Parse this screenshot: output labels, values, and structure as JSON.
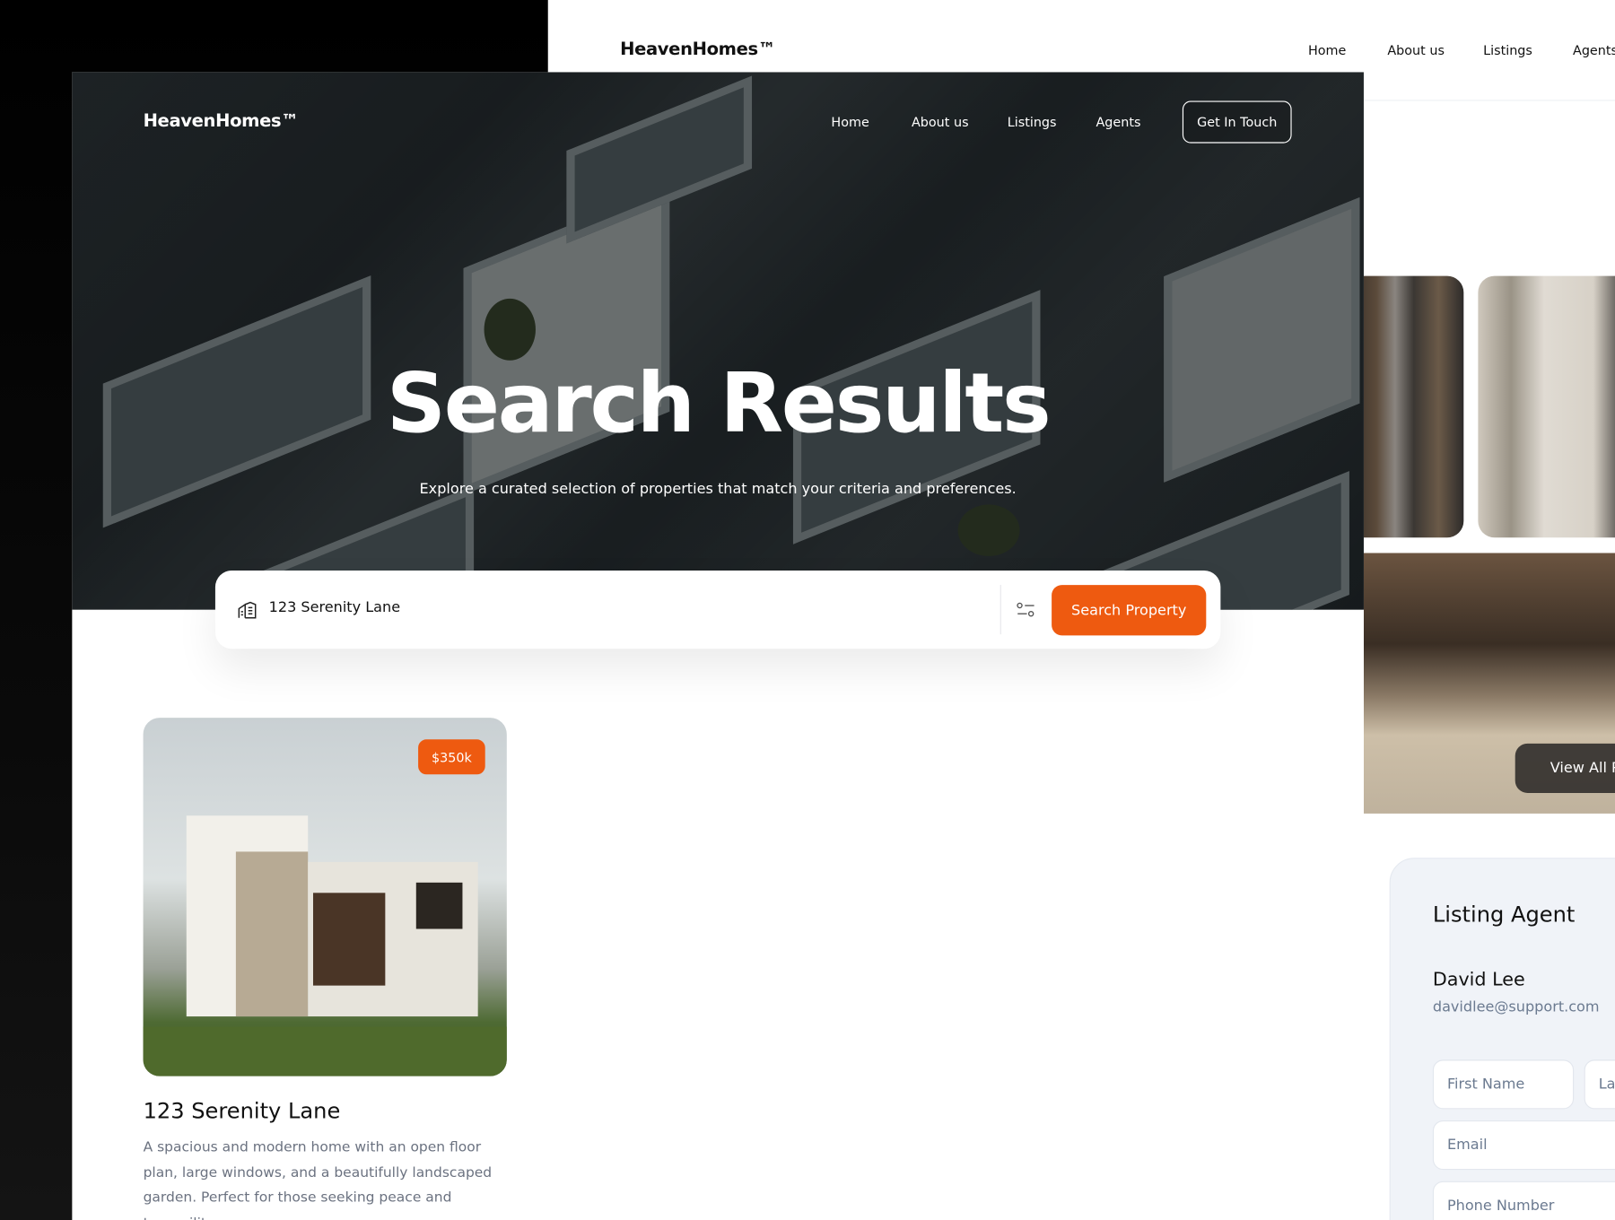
{
  "back_page": {
    "logo": "HeavenHomes™",
    "nav": [
      "Home",
      "About us",
      "Listings",
      "Agents"
    ],
    "gallery_button": "View All Photos",
    "agent": {
      "heading": "Listing Agent",
      "name": "David Lee",
      "email": "davidlee@support.com",
      "form": {
        "first_name": "First Name",
        "last_name": "Last Name",
        "email": "Email",
        "phone": "Phone Number"
      }
    }
  },
  "front_page": {
    "logo": "HeavenHomes™",
    "nav": [
      "Home",
      "About us",
      "Listings",
      "Agents"
    ],
    "cta": "Get In Touch",
    "title": "Search Results",
    "subtitle": "Explore a curated selection of properties that match your criteria and preferences.",
    "search": {
      "value": "123 Serenity Lane",
      "button": "Search Property",
      "icon": "building-icon",
      "filter_icon": "sliders-icon"
    },
    "listing": {
      "price": "$350k",
      "title": "123 Serenity Lane",
      "description": "A spacious and modern home with an open floor plan, large windows, and a beautifully landscaped garden. Perfect for those seeking peace and tranquility."
    }
  },
  "colors": {
    "accent": "#EE5A10",
    "agent_card_bg": "#F0F3F8",
    "text_muted": "#6B7280"
  }
}
